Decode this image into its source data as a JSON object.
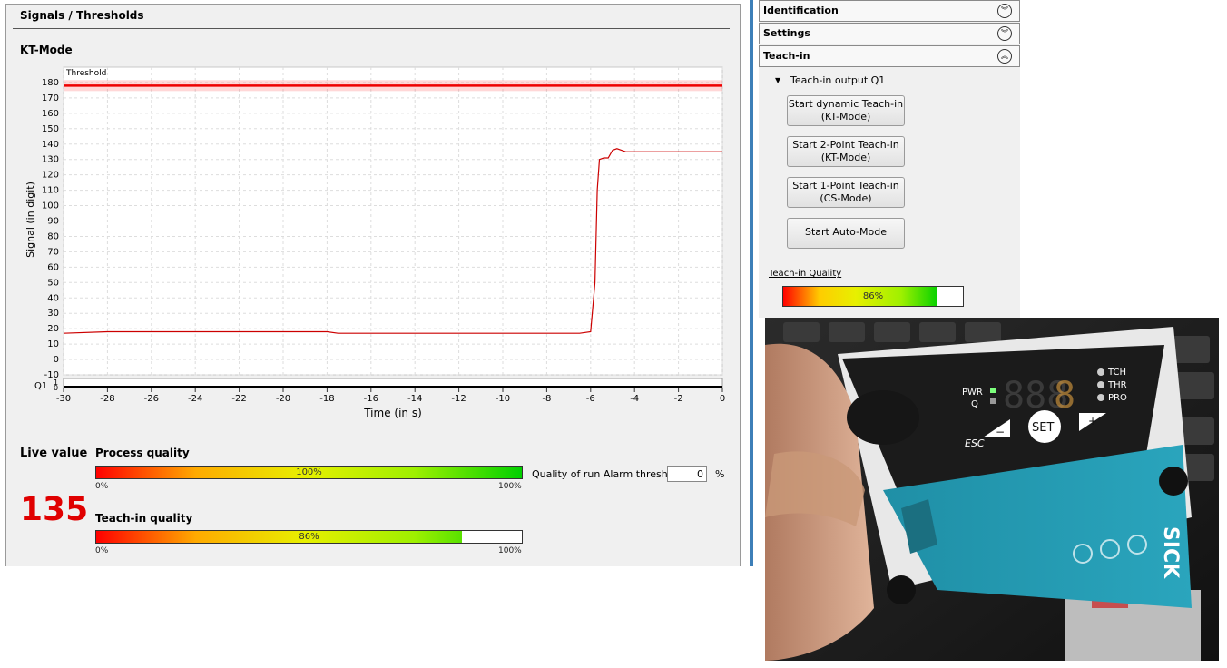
{
  "signals": {
    "title": "Signals / Thresholds",
    "mode": "KT-Mode",
    "threshold_label": "Threshold",
    "q1_label": "Q1",
    "q1_ticks": [
      "1",
      "0"
    ]
  },
  "chart_data": {
    "type": "line",
    "title": "",
    "xlabel": "Time (in s)",
    "ylabel": "Signal (in digit)",
    "xlim": [
      -30,
      0
    ],
    "ylim": [
      -10,
      190
    ],
    "x_ticks": [
      -30,
      -28,
      -26,
      -24,
      -22,
      -20,
      -18,
      -16,
      -14,
      -12,
      -10,
      -8,
      -6,
      -4,
      -2,
      0
    ],
    "y_ticks": [
      -10,
      0,
      10,
      20,
      30,
      40,
      50,
      60,
      70,
      80,
      90,
      100,
      110,
      120,
      130,
      140,
      150,
      160,
      170,
      180
    ],
    "threshold": 178,
    "grid": true,
    "series": [
      {
        "color": "#cc0000",
        "x": [
          -30,
          -28,
          -26,
          -24,
          -22,
          -20,
          -18,
          -17.5,
          -16,
          -14,
          -12,
          -10,
          -8,
          -6.5,
          -6,
          -5.8,
          -5.7,
          -5.6,
          -5.4,
          -5.2,
          -5,
          -4.8,
          -4.4,
          -4,
          -3,
          -2,
          -1,
          0
        ],
        "y": [
          17,
          18,
          18,
          18,
          18,
          18,
          18,
          17,
          17,
          17,
          17,
          17,
          17,
          17,
          18,
          50,
          110,
          130,
          131,
          131,
          136,
          137,
          135,
          135,
          135,
          135,
          135,
          135
        ]
      }
    ]
  },
  "live": {
    "label": "Live value",
    "value": "135",
    "value_color": "#e00000"
  },
  "process_quality": {
    "label": "Process quality",
    "value": 100,
    "value_text": "100%",
    "min_label": "0%",
    "max_label": "100%"
  },
  "alarm": {
    "label": "Quality of run Alarm threshold",
    "value": "0",
    "unit": "%"
  },
  "teach_quality": {
    "label": "Teach-in quality",
    "value": 86,
    "value_text": "86%",
    "min_label": "0%",
    "max_label": "100%"
  },
  "sidebar": {
    "identification": "Identification",
    "settings": "Settings",
    "teachin": "Teach-in",
    "section_label": "Teach-in output Q1",
    "buttons": [
      {
        "line1": "Start dynamic Teach-in",
        "line2": "(KT-Mode)"
      },
      {
        "line1": "Start 2-Point Teach-in",
        "line2": "(KT-Mode)"
      },
      {
        "line1": "Start 1-Point Teach-in",
        "line2": "(CS-Mode)"
      },
      {
        "line1": "Start Auto-Mode",
        "line2": ""
      }
    ],
    "quality_label": "Teach-in Quality",
    "quality_value": 86,
    "quality_text": "86%"
  },
  "device": {
    "brand": "SICK",
    "display": "888",
    "leds": [
      "PWR",
      "Q"
    ],
    "status_leds": [
      "TCH",
      "THR",
      "PRO"
    ],
    "keys": {
      "minus": "−",
      "set": "SET",
      "plus": "+",
      "esc": "ESC"
    }
  }
}
